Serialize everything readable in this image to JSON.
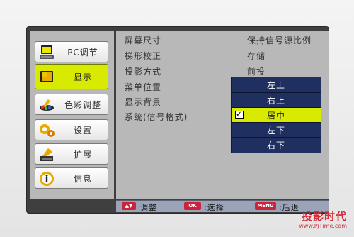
{
  "sidebar": {
    "items": [
      {
        "label": "PC调节",
        "icon": "monitor-keyboard-icon"
      },
      {
        "label": "显示",
        "icon": "display-icon"
      },
      {
        "label": "色彩调整",
        "icon": "color-adjust-icon"
      },
      {
        "label": "设置",
        "icon": "gears-icon"
      },
      {
        "label": "扩展",
        "icon": "expand-icon"
      },
      {
        "label": "信息",
        "icon": "info-icon"
      }
    ],
    "active_index": 1
  },
  "settings": {
    "rows": [
      {
        "label": "屏幕尺寸",
        "value": "保持信号源比例"
      },
      {
        "label": "梯形校正",
        "value": "存储"
      },
      {
        "label": "投影方式",
        "value": "前投"
      },
      {
        "label": "菜单位置",
        "value": ""
      },
      {
        "label": "显示背景",
        "value": ""
      },
      {
        "label": "系统(信号格式)",
        "value": ""
      }
    ]
  },
  "dropdown": {
    "items": [
      "左上",
      "右上",
      "居中",
      "左下",
      "右下"
    ],
    "selected": "居中",
    "check_mark": "☑"
  },
  "bottom_bar": {
    "adjust_key": "▲▼",
    "adjust_label": "调整",
    "select_key": "OK",
    "select_label": ":选择",
    "back_key": "MENU",
    "back_label": ":后退"
  },
  "watermark": {
    "title": "投影时代",
    "url": "www.PjTime.com"
  },
  "colors": {
    "panel": "#b8b8b8",
    "highlight": "#d8ea00",
    "dropdown_bg": "#1f3060",
    "key_red": "#c9243a"
  }
}
